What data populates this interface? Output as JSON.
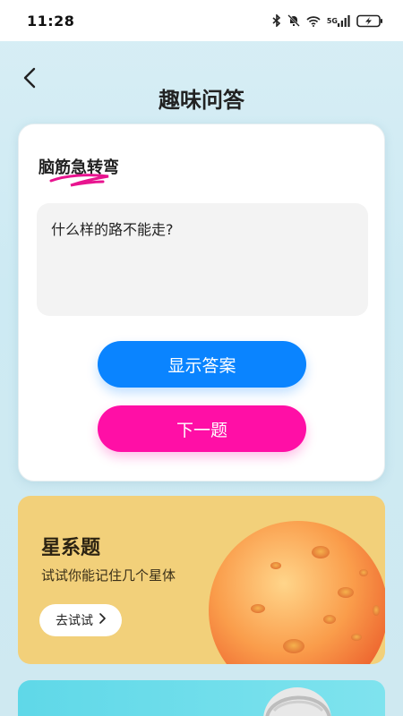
{
  "status_bar": {
    "time": "11:28",
    "icons": [
      "bluetooth-icon",
      "mute-bell-icon",
      "wifi-icon",
      "cellular-5g-icon",
      "battery-charging-icon"
    ],
    "network_label": "5G"
  },
  "header": {
    "back_icon": "back-chevron-icon",
    "title": "趣味问答"
  },
  "quiz": {
    "title": "脑筋急转弯",
    "question": "什么样的路不能走?",
    "show_answer_label": "显示答案",
    "next_label": "下一题",
    "colors": {
      "answer_button": "#0a84ff",
      "next_button": "#ff0fa6",
      "swoosh": "#e8148f"
    }
  },
  "cards": [
    {
      "title": "星系题",
      "subtitle": "试试你能记住几个星体",
      "button_label": "去试试",
      "button_icon": "chevron-right-icon",
      "image": "planet-image",
      "color": "#f2d07a"
    },
    {
      "image": "figure-image",
      "color": "#5fd8e8"
    }
  ]
}
